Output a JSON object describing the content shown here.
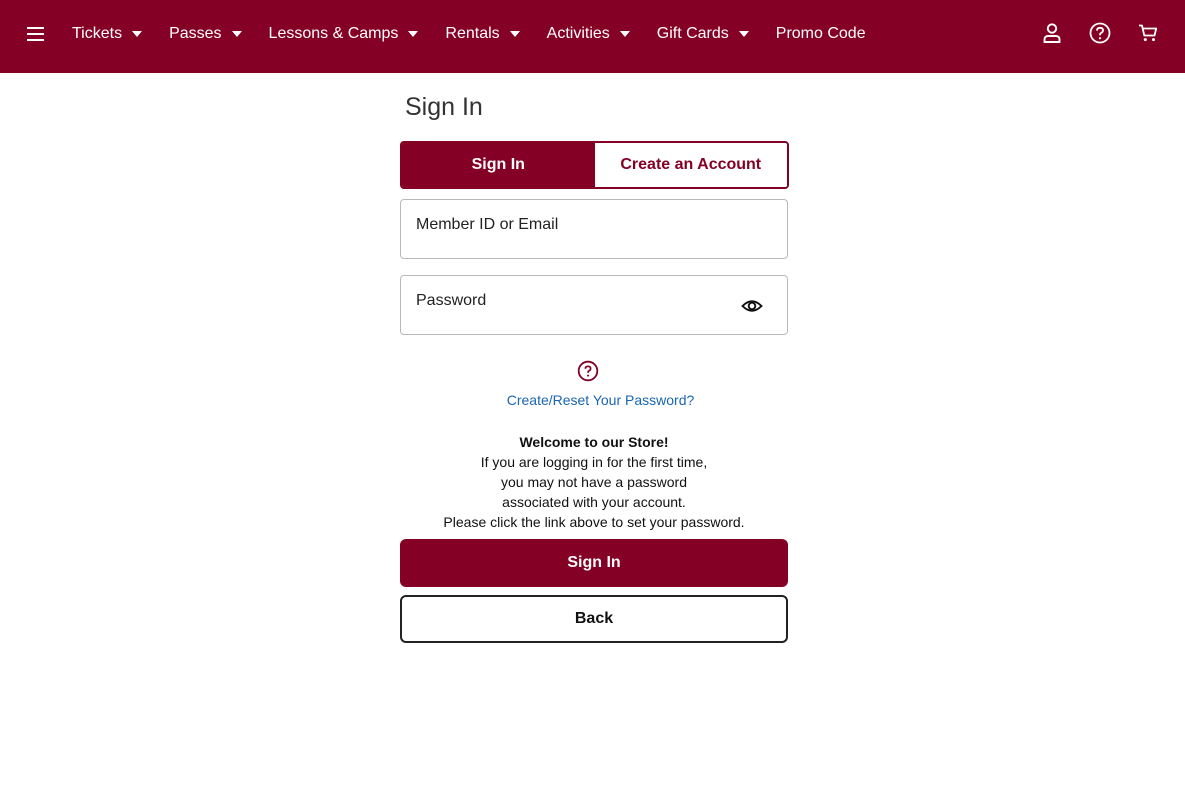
{
  "nav": {
    "items": [
      {
        "label": "Tickets",
        "has_dropdown": true
      },
      {
        "label": "Passes",
        "has_dropdown": true
      },
      {
        "label": "Lessons & Camps",
        "has_dropdown": true
      },
      {
        "label": "Rentals",
        "has_dropdown": true
      },
      {
        "label": "Activities",
        "has_dropdown": true
      },
      {
        "label": "Gift Cards",
        "has_dropdown": true
      },
      {
        "label": "Promo Code",
        "has_dropdown": false
      }
    ],
    "icons": [
      "menu-icon",
      "account-icon",
      "help-icon",
      "cart-icon"
    ]
  },
  "page": {
    "title": "Sign In"
  },
  "tabs": {
    "sign_in": "Sign In",
    "create_account": "Create an Account",
    "active": "sign_in"
  },
  "form": {
    "email_placeholder": "Member ID or Email",
    "email_value": "",
    "password_placeholder": "Password",
    "password_value": "",
    "reset_link": "Create/Reset Your Password?"
  },
  "welcome": {
    "title": "Welcome to our Store!",
    "line1": "If you are logging in for the first time,",
    "line2": "you may not have a password",
    "line3": "associated with your account.",
    "line4": "Please click the link above to set your password."
  },
  "buttons": {
    "sign_in": "Sign In",
    "back": "Back"
  },
  "colors": {
    "brand": "#840024",
    "link": "#1a66b3"
  }
}
